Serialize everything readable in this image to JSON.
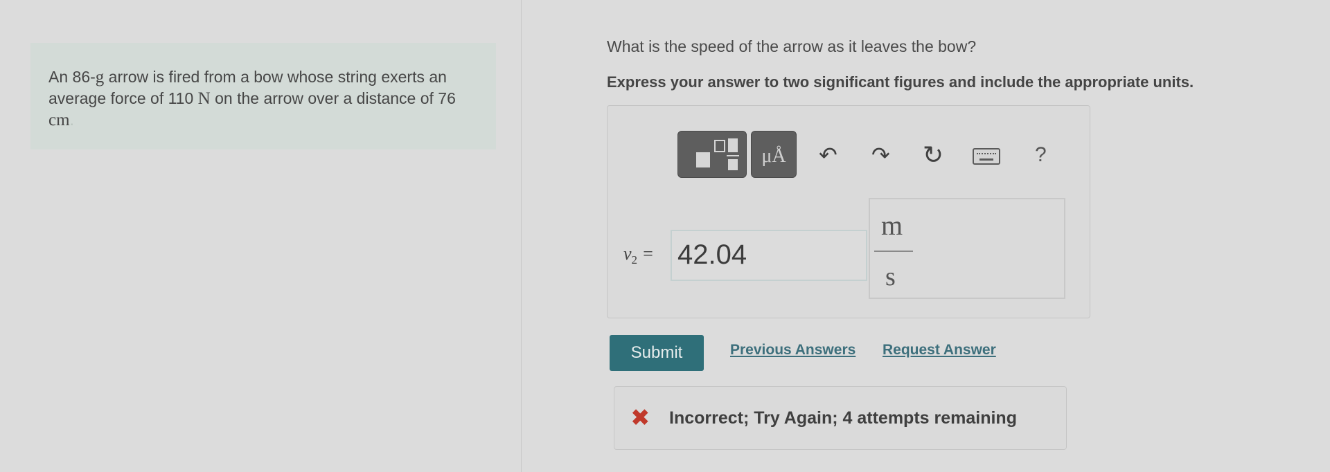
{
  "problem": {
    "text_part1": "An 86-",
    "unit_g": "g",
    "text_part2": " arrow is fired from a bow whose string exerts an average force of 110 ",
    "unit_N": "N",
    "text_part3": " on the arrow over a distance of 76 ",
    "unit_cm": "cm",
    "end_dot": "."
  },
  "question": "What is the speed of the arrow as it leaves the bow?",
  "instruction": "Express your answer to two significant figures and include the appropriate units.",
  "toolbar": {
    "units_label": "μÅ",
    "help_label": "?"
  },
  "answer": {
    "variable": "v",
    "variable_subscript": "2",
    "equals": " =",
    "value": "42.04",
    "unit_numerator": "m",
    "unit_denominator": "s"
  },
  "actions": {
    "submit_label": "Submit",
    "previous_answers": "Previous Answers",
    "request_answer": "Request Answer"
  },
  "feedback": {
    "text": "Incorrect; Try Again; 4 attempts remaining"
  },
  "colors": {
    "submit_bg": "#2f6f79",
    "link": "#3d6f7c",
    "error": "#c0392b"
  }
}
